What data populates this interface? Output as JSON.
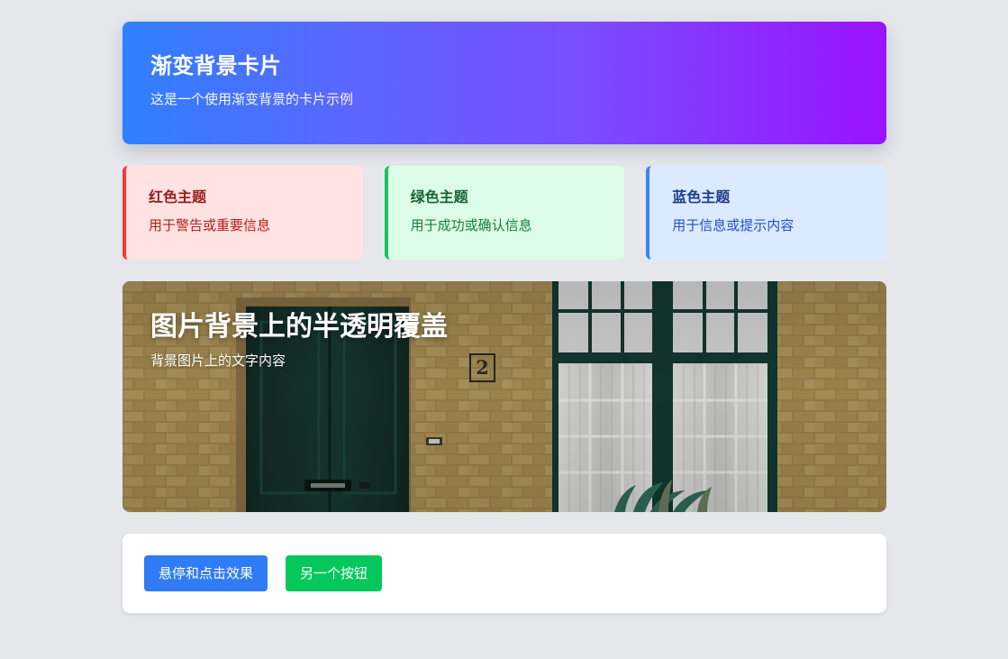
{
  "hero": {
    "title": "渐变背景卡片",
    "subtitle": "这是一个使用渐变背景的卡片示例"
  },
  "themes": [
    {
      "title": "红色主题",
      "description": "用于警告或重要信息"
    },
    {
      "title": "绿色主题",
      "description": "用于成功或确认信息"
    },
    {
      "title": "蓝色主题",
      "description": "用于信息或提示内容"
    }
  ],
  "image_card": {
    "title": "图片背景上的半透明覆盖",
    "subtitle": "背景图片上的文字内容",
    "house_number": "2"
  },
  "actions": {
    "primary_label": "悬停和点击效果",
    "secondary_label": "另一个按钮"
  },
  "colors": {
    "page_bg": "#e5e7eb",
    "gradient_start": "#2f80ff",
    "gradient_end": "#9a12ff",
    "red_accent": "#ef3b3b",
    "green_accent": "#16c45f",
    "blue_accent": "#3b82f6",
    "primary_button": "#2f7cf6",
    "success_button": "#04c85b"
  }
}
